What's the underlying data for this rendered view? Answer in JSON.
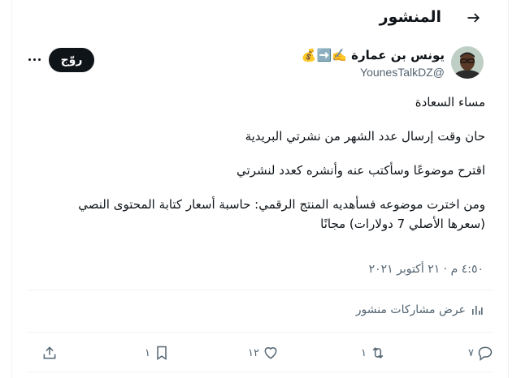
{
  "header": {
    "title": "المنشور",
    "back_icon": "arrow-right-icon"
  },
  "post": {
    "author_name": "يونس بن عمارة",
    "author_emojis": [
      "✍️",
      "➡️",
      "💰"
    ],
    "handle": "@YounesTalkDZ",
    "follow_label": "روّج",
    "lines": [
      "مساء السعادة",
      "حان وقت إرسال عدد الشهر من نشرتي البريدية",
      "اقترح موضوعًا وسأكتب عنه وأنشره كعدد لنشرتي",
      "ومن اخترت موضوعه فسأهديه المنتج الرقمي: حاسبة أسعار كتابة المحتوى النصي (سعرها الأصلي 7 دولارات) مجانًا"
    ],
    "timestamp": "٤:٥٠ م · ٢١ أكتوبر ٢٠٢١",
    "engagements_label": "عرض مشاركات منشور"
  },
  "actions": {
    "replies": "٧",
    "reposts": "١",
    "likes": "١٢",
    "bookmarks": "١"
  },
  "colors": {
    "text": "#0f1419",
    "secondary": "#536471",
    "border": "#eff3f4",
    "button": "#0f1419"
  }
}
